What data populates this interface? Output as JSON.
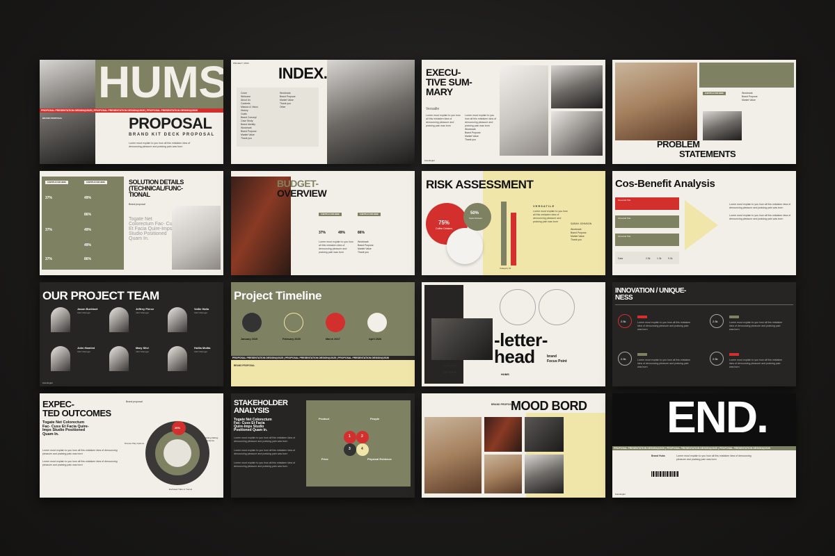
{
  "slides": {
    "s1": {
      "header": "PROJECT | PRO",
      "year": "2026",
      "title": "HUMS",
      "subtitle": "PROPOSAL",
      "tag": "BRAND KIT DECK PROPOSAL",
      "band": "PROPOSAL PRESENTATION DESIGN@2025 | PROPOSAL PRESENTATION DESIGN@2025 | PROPOSAL PRESENTATION DESIGN@2026",
      "label": "BRAND PROPOSAL"
    },
    "s2": {
      "title": "INDEX.",
      "items_left": [
        "Cover",
        "Welcome",
        "About Us",
        "Contents",
        "Mission & Vision",
        "History",
        "Goals",
        "Brand Concept",
        "Case Study",
        "Brand Identity",
        "Wordmark",
        "Brand Purpose",
        "Market Value",
        "Thank you",
        "Other"
      ],
      "items_right": [
        "Wordmark",
        "Brand Purpose",
        "Market Value",
        "Thank you",
        "Other"
      ]
    },
    "s3": {
      "title_line1": "EXECU-",
      "title_line2": "TIVE SUM-",
      "title_line3": "MARY",
      "sub": "Versatile",
      "list": [
        "Wordmark",
        "Brand Purpose",
        "Market Value",
        "Thank you"
      ]
    },
    "s4": {
      "title_line1": "PROBLEM",
      "title_line2": "STATEMENTS",
      "tag": "SUBTITLE FOR HERE",
      "list": [
        "Wordmark",
        "Brand Purpose",
        "Market Value"
      ]
    },
    "s5": {
      "title_line1": "SOLUTION DETAILS",
      "title_line2": "(TECHNICAL/FUNC-",
      "title_line3": "TIONAL",
      "tag": "SUBTITLE FOR HERE",
      "pcts": [
        "37%",
        "49%",
        "37%",
        "49%",
        "86%",
        "37%",
        "49%",
        "86%"
      ],
      "label": "Brand proposal",
      "quote": "Togate Net Colorectum Fac- Cuss Et Facia Quire-Imps Studio Positioned Quam In."
    },
    "s6": {
      "title_line1": "BUDGET-",
      "title_line2": "OVERVIEW",
      "tag": "SUBTITLE FOR HERE",
      "pcts": [
        "37%",
        "49%",
        "86%"
      ],
      "list": [
        "Wordmark",
        "Brand Purpose",
        "Market Value",
        "Thank you"
      ]
    },
    "s7": {
      "title": "RISK ASSESSMENT",
      "pct1": "75%",
      "pct1_label": "Coffee Drinkers",
      "pct2": "50%",
      "pct2_label": "Soda Drinkers",
      "sub": "VERSATILE",
      "category": "Category 01",
      "name": "SARAH JOHNSON",
      "list": [
        "Wordmark",
        "Brand Purpose",
        "Market Value",
        "Thank you"
      ]
    },
    "s8": {
      "title": "Cos-Benefit Analysis",
      "row_title": "Financial Title",
      "row_label": "Data",
      "vals": [
        "2.5k",
        "1.3k",
        "9.0k"
      ]
    },
    "s9": {
      "title": "OUR PROJECT TEAM",
      "members": [
        {
          "name": "Jason Burkhart",
          "role": "CEO Manager"
        },
        {
          "name": "Jeffrey Pierce",
          "role": "CEO Manager"
        },
        {
          "name": "Vollie Hailo",
          "role": "CEO Manager"
        },
        {
          "name": "John Hamled",
          "role": "CEO Manager"
        },
        {
          "name": "Mary Silvi",
          "role": "CEO Manager"
        },
        {
          "name": "Hollia Mollia",
          "role": "CEO Manager"
        }
      ]
    },
    "s10": {
      "title": "Project Timeline",
      "dates": [
        "January 2025",
        "February 2025",
        "March 2027",
        "April 2026"
      ],
      "band": "PROPOSAL PRESENTATION DESIGN@2025 | PROPOSAL PRESENTATION DESIGN@2025 | PROPOSAL PRESENTATION DESIGN@2026",
      "label": "BRAND PROPOSAL"
    },
    "s11": {
      "title_line1": "-letter-",
      "title_line2": "head",
      "side1": "brand",
      "side2": "Focus Point",
      "sign": "HUMS",
      "sub": "Jennifer Wilson",
      "amount": "1.5K SMILE"
    },
    "s12": {
      "title_line1": "INNOVATION / UNIQUE-",
      "title_line2": "NESS",
      "vals": [
        "2.5k",
        "2.5k",
        "2.5k",
        "2.5k"
      ]
    },
    "s13": {
      "title_line1": "EXPEC-",
      "title_line2": "TED OUTCOMES",
      "label": "Brand proposal",
      "quote": "Togate Net Colorectum Fac- Cuss Et Facia Quire-Imps Studio Positioned Quam In.",
      "pct": "20%",
      "c1": "Diverse Play Options",
      "c2": "Thrilling Sliding Experience",
      "c3": "Enclosed Tube or Tunnel"
    },
    "s14": {
      "title_line1": "STAKEHOLDER",
      "title_line2": "ANALYSIS",
      "quote": "Togate Net Colorectum Fac- Cuss Et Facia Quire-Imps Studio Positioned Quam In.",
      "quad": [
        "Product",
        "People",
        "Price",
        "Physical Evidence"
      ],
      "nums": [
        "1",
        "2",
        "3",
        "4"
      ]
    },
    "s15": {
      "title": "MOOD BORD",
      "label": "BRAND PROPOSAL"
    },
    "s16": {
      "title": "END.",
      "band": "PROPOSAL PRESENTATION DESIGN@2025 | PROPOSAL PRESENTATION DESIGN@2025 | PROPOSAL PRESENTATION DESIGN@2026",
      "label": "Brand Hubs"
    }
  },
  "common": {
    "logo": "brandingkit",
    "header_left": "PROJECT | PRO",
    "header_mid": "2026",
    "header_right": "Hum Template",
    "lorem": "Lorem must explain to you how all this mistaken idea of denouncing pleasure and praising pain was born"
  },
  "colors": {
    "olive": "#7e8262",
    "cream": "#f1e6a9",
    "red": "#d22f2d",
    "dark": "#262524",
    "paper": "#f1efe8"
  }
}
